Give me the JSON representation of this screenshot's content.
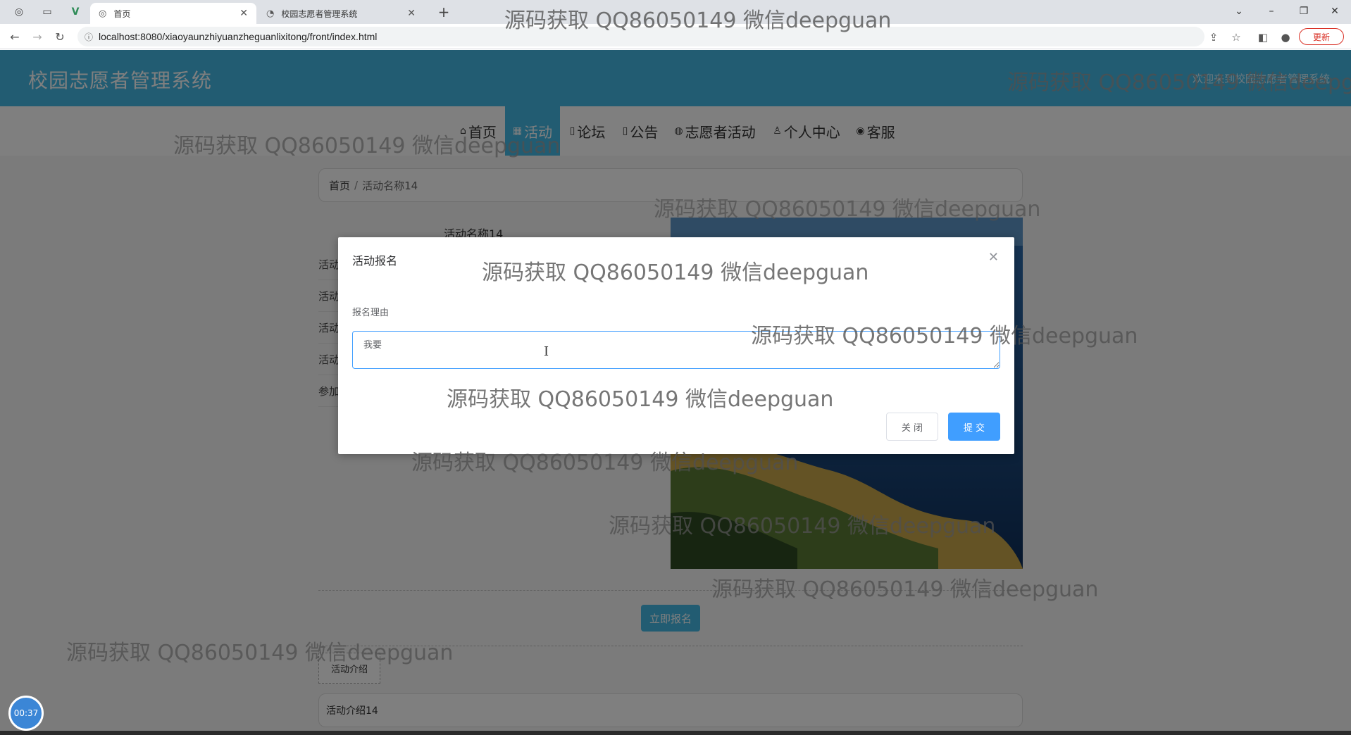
{
  "browser": {
    "tabs": [
      {
        "title": "首页",
        "active": true
      },
      {
        "title": "校园志愿者管理系统",
        "active": false
      }
    ],
    "url": "localhost:8080/xiaoyaunzhiyuanzheguanlixitong/front/index.html",
    "update_label": "更新"
  },
  "site": {
    "title": "校园志愿者管理系统",
    "welcome": "欢迎来到校园志愿者管理系统",
    "nav": [
      {
        "label": "首页",
        "icon": "home-icon",
        "active": false
      },
      {
        "label": "活动",
        "icon": "grid-icon",
        "active": true
      },
      {
        "label": "论坛",
        "icon": "forum-icon",
        "active": false
      },
      {
        "label": "公告",
        "icon": "notice-icon",
        "active": false
      },
      {
        "label": "志愿者活动",
        "icon": "palette-icon",
        "active": false
      },
      {
        "label": "个人中心",
        "icon": "user-icon",
        "active": false
      },
      {
        "label": "客服",
        "icon": "service-icon",
        "active": false
      }
    ]
  },
  "breadcrumb": {
    "home": "首页",
    "separator": "/",
    "current": "活动名称14"
  },
  "detail": {
    "title": "活动名称14",
    "rows": [
      "活动",
      "活动",
      "活动",
      "活动",
      "参加"
    ]
  },
  "signup_button": "立即报名",
  "intro": {
    "tab_label": "活动介绍",
    "content": "活动介绍14"
  },
  "dialog": {
    "title": "活动报名",
    "field_label": "报名理由",
    "field_value": "我要",
    "close_button": "关 闭",
    "submit_button": "提 交"
  },
  "watermark_text": "源码获取 QQ86050149 微信deepguan",
  "timer": "00:37"
}
